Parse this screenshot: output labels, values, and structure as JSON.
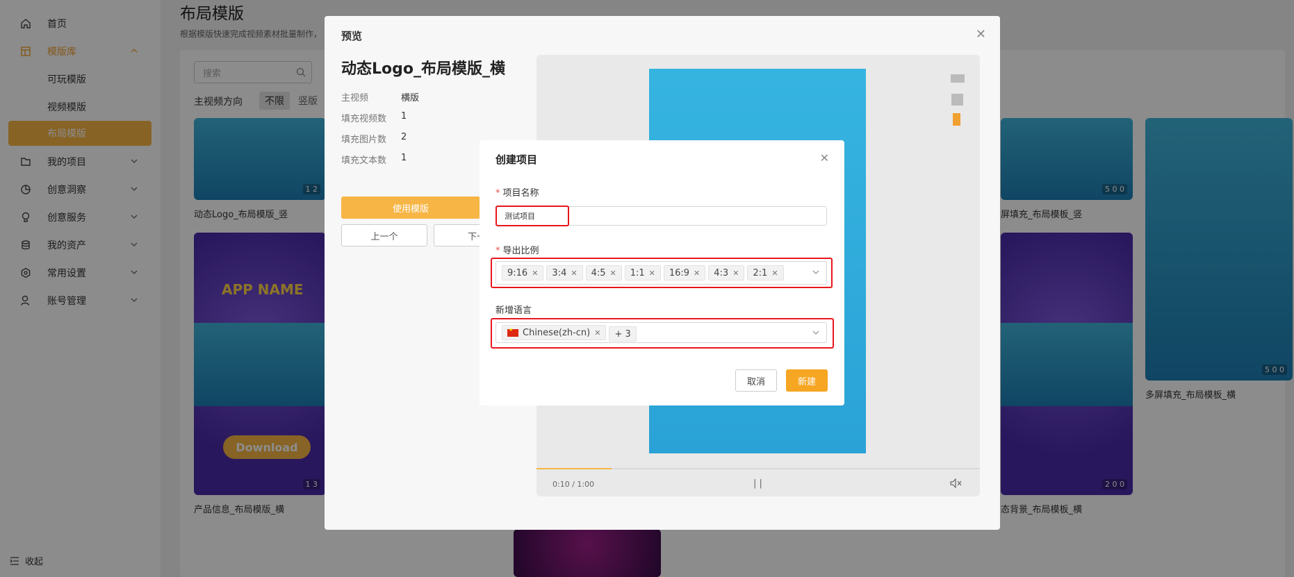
{
  "sidebar": {
    "items": [
      {
        "label": "首页",
        "icon": "home-icon"
      },
      {
        "label": "模版库",
        "icon": "template-icon"
      },
      {
        "label": "可玩模版"
      },
      {
        "label": "视频模版"
      },
      {
        "label": "布局模版"
      },
      {
        "label": "我的项目",
        "icon": "folder-icon"
      },
      {
        "label": "创意洞察",
        "icon": "chart-icon"
      },
      {
        "label": "创意服务",
        "icon": "bulb-icon"
      },
      {
        "label": "我的资产",
        "icon": "database-icon"
      },
      {
        "label": "常用设置",
        "icon": "settings-icon"
      },
      {
        "label": "账号管理",
        "icon": "user-icon"
      }
    ],
    "collapse_label": "收起"
  },
  "main": {
    "title": "布局模版",
    "subtitle": "根据模版快速完成视频素材批量制作，",
    "search_placeholder": "搜索",
    "filter_label": "主视频方向",
    "filters": [
      "不限",
      "竖版"
    ],
    "cards": [
      {
        "label": "动态Logo_布局模版_竖",
        "badge": "1  2"
      },
      {
        "label": "产品信息_布局模版_横",
        "badge": "1  3",
        "button": "Download",
        "app_name": "APP NAME"
      },
      {
        "label": "屏填充_布局模板_竖",
        "badge": "5  0  0"
      },
      {
        "label": "态背景_布局模板_横",
        "badge": "2  0  0"
      },
      {
        "label": "多屏填充_布局模板_横",
        "badge": "5  0  0"
      }
    ]
  },
  "preview": {
    "title": "预览",
    "template_name": "动态Logo_布局模版_横",
    "info": [
      {
        "key": "主视频",
        "value": "横版"
      },
      {
        "key": "填充视频数",
        "value": "1"
      },
      {
        "key": "填充图片数",
        "value": "2"
      },
      {
        "key": "填充文本数",
        "value": "1"
      }
    ],
    "use_button": "使用模版",
    "prev_button": "上一个",
    "next_button": "下一",
    "time": "0:10 / 1:00",
    "progress": 0.17
  },
  "create_dialog": {
    "title": "创建项目",
    "name_label": "项目名称",
    "name_value": "测试项目",
    "ratio_label": "导出比例",
    "ratios": [
      "9:16",
      "3:4",
      "4:5",
      "1:1",
      "16:9",
      "4:3",
      "2:1"
    ],
    "language_label": "新增语言",
    "language_tag": "Chinese(zh-cn)",
    "language_more": "+ 3",
    "cancel_button": "取消",
    "ok_button": "新建"
  },
  "colors": {
    "accent": "#f6b544",
    "highlight": "#e8161c",
    "primary_button": "#f6a623"
  }
}
